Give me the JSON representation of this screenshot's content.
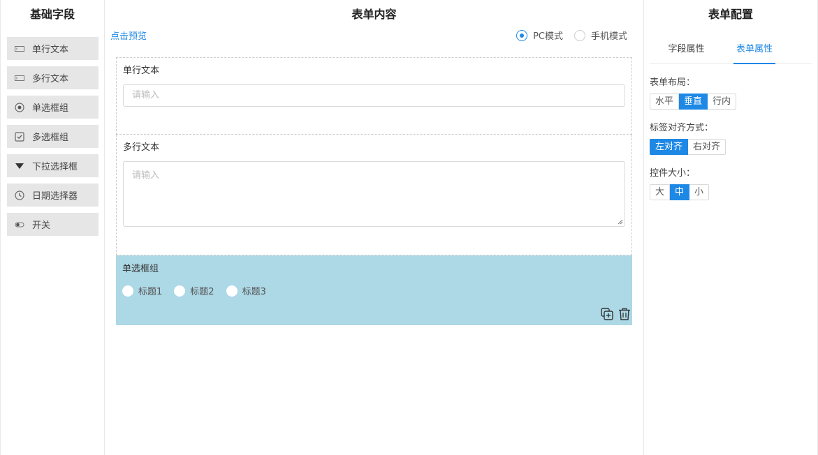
{
  "left": {
    "title": "基础字段",
    "items": [
      {
        "label": "单行文本",
        "icon": "single-line-icon"
      },
      {
        "label": "多行文本",
        "icon": "multi-line-icon"
      },
      {
        "label": "单选框组",
        "icon": "radio-icon"
      },
      {
        "label": "多选框组",
        "icon": "checkbox-icon"
      },
      {
        "label": "下拉选择框",
        "icon": "dropdown-icon"
      },
      {
        "label": "日期选择器",
        "icon": "clock-icon"
      },
      {
        "label": "开关",
        "icon": "switch-icon"
      }
    ]
  },
  "center": {
    "title": "表单内容",
    "preview": "点击预览",
    "modes": [
      {
        "label": "PC模式",
        "selected": true
      },
      {
        "label": "手机模式",
        "selected": false
      }
    ],
    "fields": {
      "single": {
        "label": "单行文本",
        "placeholder": "请输入"
      },
      "multi": {
        "label": "多行文本",
        "placeholder": "请输入"
      },
      "radio": {
        "label": "单选框组",
        "options": [
          "标题1",
          "标题2",
          "标题3"
        ]
      }
    },
    "selected_color": "#add8e6"
  },
  "right": {
    "title": "表单配置",
    "tabs": [
      {
        "label": "字段属性",
        "active": false
      },
      {
        "label": "表单属性",
        "active": true
      }
    ],
    "layout": {
      "label": "表单布局：",
      "options": [
        "水平",
        "垂直",
        "行内"
      ],
      "selected": "垂直"
    },
    "align": {
      "label": "标签对齐方式：",
      "options": [
        "左对齐",
        "右对齐"
      ],
      "selected": "左对齐"
    },
    "size": {
      "label": "控件大小：",
      "options": [
        "大",
        "中",
        "小"
      ],
      "selected": "中"
    }
  },
  "accent": "#1e88e5"
}
